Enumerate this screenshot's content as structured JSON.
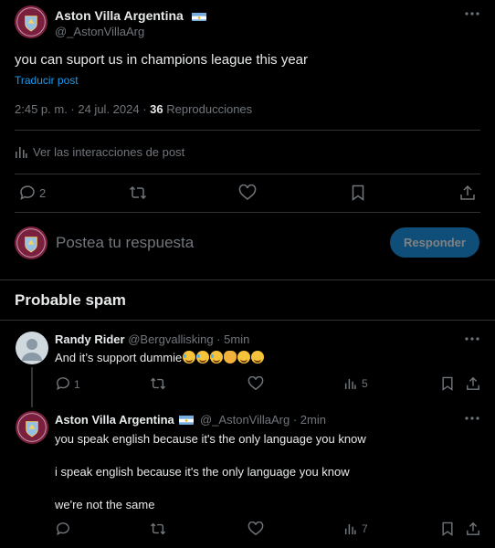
{
  "main_post": {
    "author_name": "Aston Villa Argentina",
    "handle": "@_AstonVillaArg",
    "text": "you can suport us in champions league this year",
    "translate": "Traducir post",
    "time": "2:45 p. m. · 24 jul. 2024 · ",
    "views_count": "36",
    "views_label": " Reproducciones",
    "interactions": "Ver las interacciones de post",
    "replies_count": "2"
  },
  "composer": {
    "placeholder": "Postea tu respuesta",
    "button": "Responder"
  },
  "section_title": "Probable spam",
  "reply1": {
    "author_name": "Randy Rider",
    "handle": "@Bergvallisking",
    "time": "· 5min",
    "text": "And it’s support dummie",
    "replies": "1",
    "views": "5"
  },
  "reply2": {
    "author_name": "Aston Villa Argentina",
    "handle": "@_AstonVillaArg",
    "time": "· 2min",
    "line1": "you speak english because it's the only language you know",
    "line2": "i speak english because it's the only language you know",
    "line3": "we're not the same",
    "views": "7"
  },
  "colors": {
    "accent": "#1d9bf0",
    "muted": "#71767b",
    "divider": "#2f3336",
    "brand": "#7a1f3d"
  }
}
